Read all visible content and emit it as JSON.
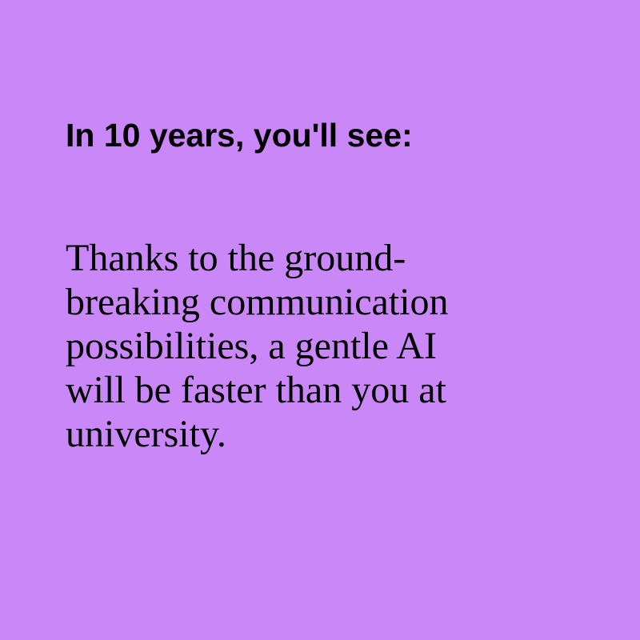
{
  "colors": {
    "background": "#c987f8",
    "text": "#000000"
  },
  "heading": "In 10 years, you'll see:",
  "body_lines": [
    "Thanks to the ground-",
    "breaking communication",
    "possibilities, a gentle AI",
    "will be faster than you at",
    "university."
  ]
}
